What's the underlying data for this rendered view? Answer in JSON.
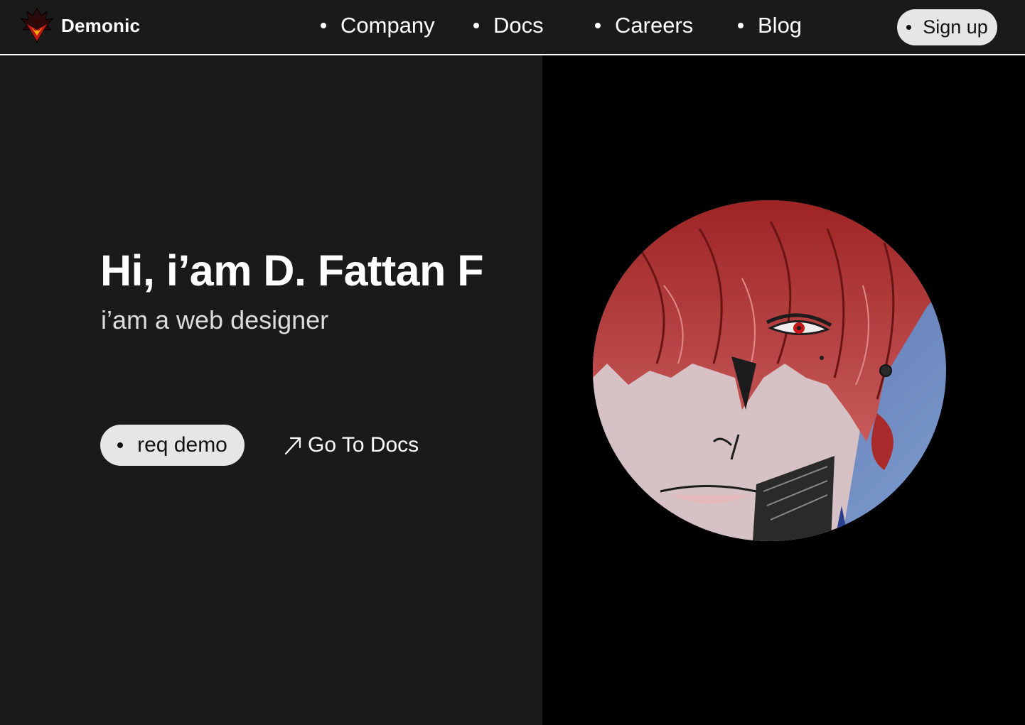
{
  "brand": {
    "name": "Demonic",
    "logo_icon": "demon-crest-icon"
  },
  "nav": {
    "items": [
      {
        "label": "Company"
      },
      {
        "label": "Docs"
      },
      {
        "label": "Careers"
      },
      {
        "label": "Blog"
      }
    ],
    "signup_label": "Sign up"
  },
  "hero": {
    "title": "Hi, i’am D. Fattan F",
    "subtitle": "i’am a web designer",
    "primary_button_label": "req demo",
    "secondary_link_label": "Go To Docs",
    "secondary_link_icon": "arrow-up-right-icon",
    "avatar_icon": "anime-character-portrait"
  },
  "colors": {
    "page_background": "#1a1a1a",
    "right_panel_background": "#000000",
    "button_background": "#e6e6e6",
    "hair_red": "#b53333",
    "skin": "#d9c6c8",
    "sky_blue": "#5a77b0"
  }
}
